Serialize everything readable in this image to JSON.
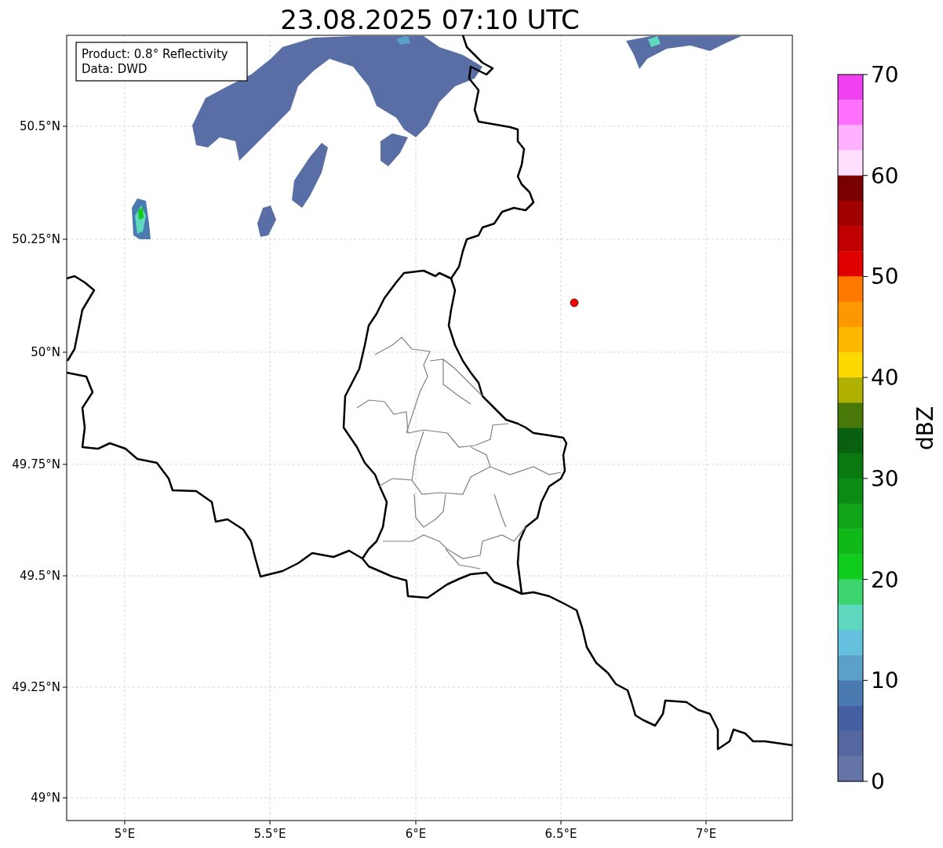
{
  "title": "23.08.2025 07:10 UTC",
  "info_box": [
    "Product: 0.8° Reflectivity",
    "Data: DWD"
  ],
  "x_ticks": [
    {
      "label": "5°E"
    },
    {
      "label": "5.5°E"
    },
    {
      "label": "6°E"
    },
    {
      "label": "6.5°E"
    },
    {
      "label": "7°E"
    }
  ],
  "y_ticks": [
    {
      "label": "50.5°N"
    },
    {
      "label": "50.25°N"
    },
    {
      "label": "50°N"
    },
    {
      "label": "49.75°N"
    },
    {
      "label": "49.5°N"
    },
    {
      "label": "49.25°N"
    },
    {
      "label": "49°N"
    }
  ],
  "colorbar": {
    "label": "dBZ",
    "ticks": [
      "70",
      "60",
      "50",
      "40",
      "30",
      "20",
      "10",
      "0"
    ],
    "bins": [
      {
        "color": "#f040f0"
      },
      {
        "color": "#ff70ff"
      },
      {
        "color": "#ffb0ff"
      },
      {
        "color": "#ffe0ff"
      },
      {
        "color": "#780000"
      },
      {
        "color": "#a00000"
      },
      {
        "color": "#c00000"
      },
      {
        "color": "#e00000"
      },
      {
        "color": "#ff7800"
      },
      {
        "color": "#ff9800"
      },
      {
        "color": "#ffb800"
      },
      {
        "color": "#ffd800"
      },
      {
        "color": "#b0b000"
      },
      {
        "color": "#487808"
      },
      {
        "color": "#086010"
      },
      {
        "color": "#0a7a10"
      },
      {
        "color": "#0c8c14"
      },
      {
        "color": "#10a418"
      },
      {
        "color": "#10b818"
      },
      {
        "color": "#10cc1c"
      },
      {
        "color": "#3cd46e"
      },
      {
        "color": "#5fd8c0"
      },
      {
        "color": "#64c0dc"
      },
      {
        "color": "#5aa0c8"
      },
      {
        "color": "#4a7ab0"
      },
      {
        "color": "#4560a2"
      },
      {
        "color": "#55679f"
      },
      {
        "color": "#6474a6"
      }
    ]
  }
}
